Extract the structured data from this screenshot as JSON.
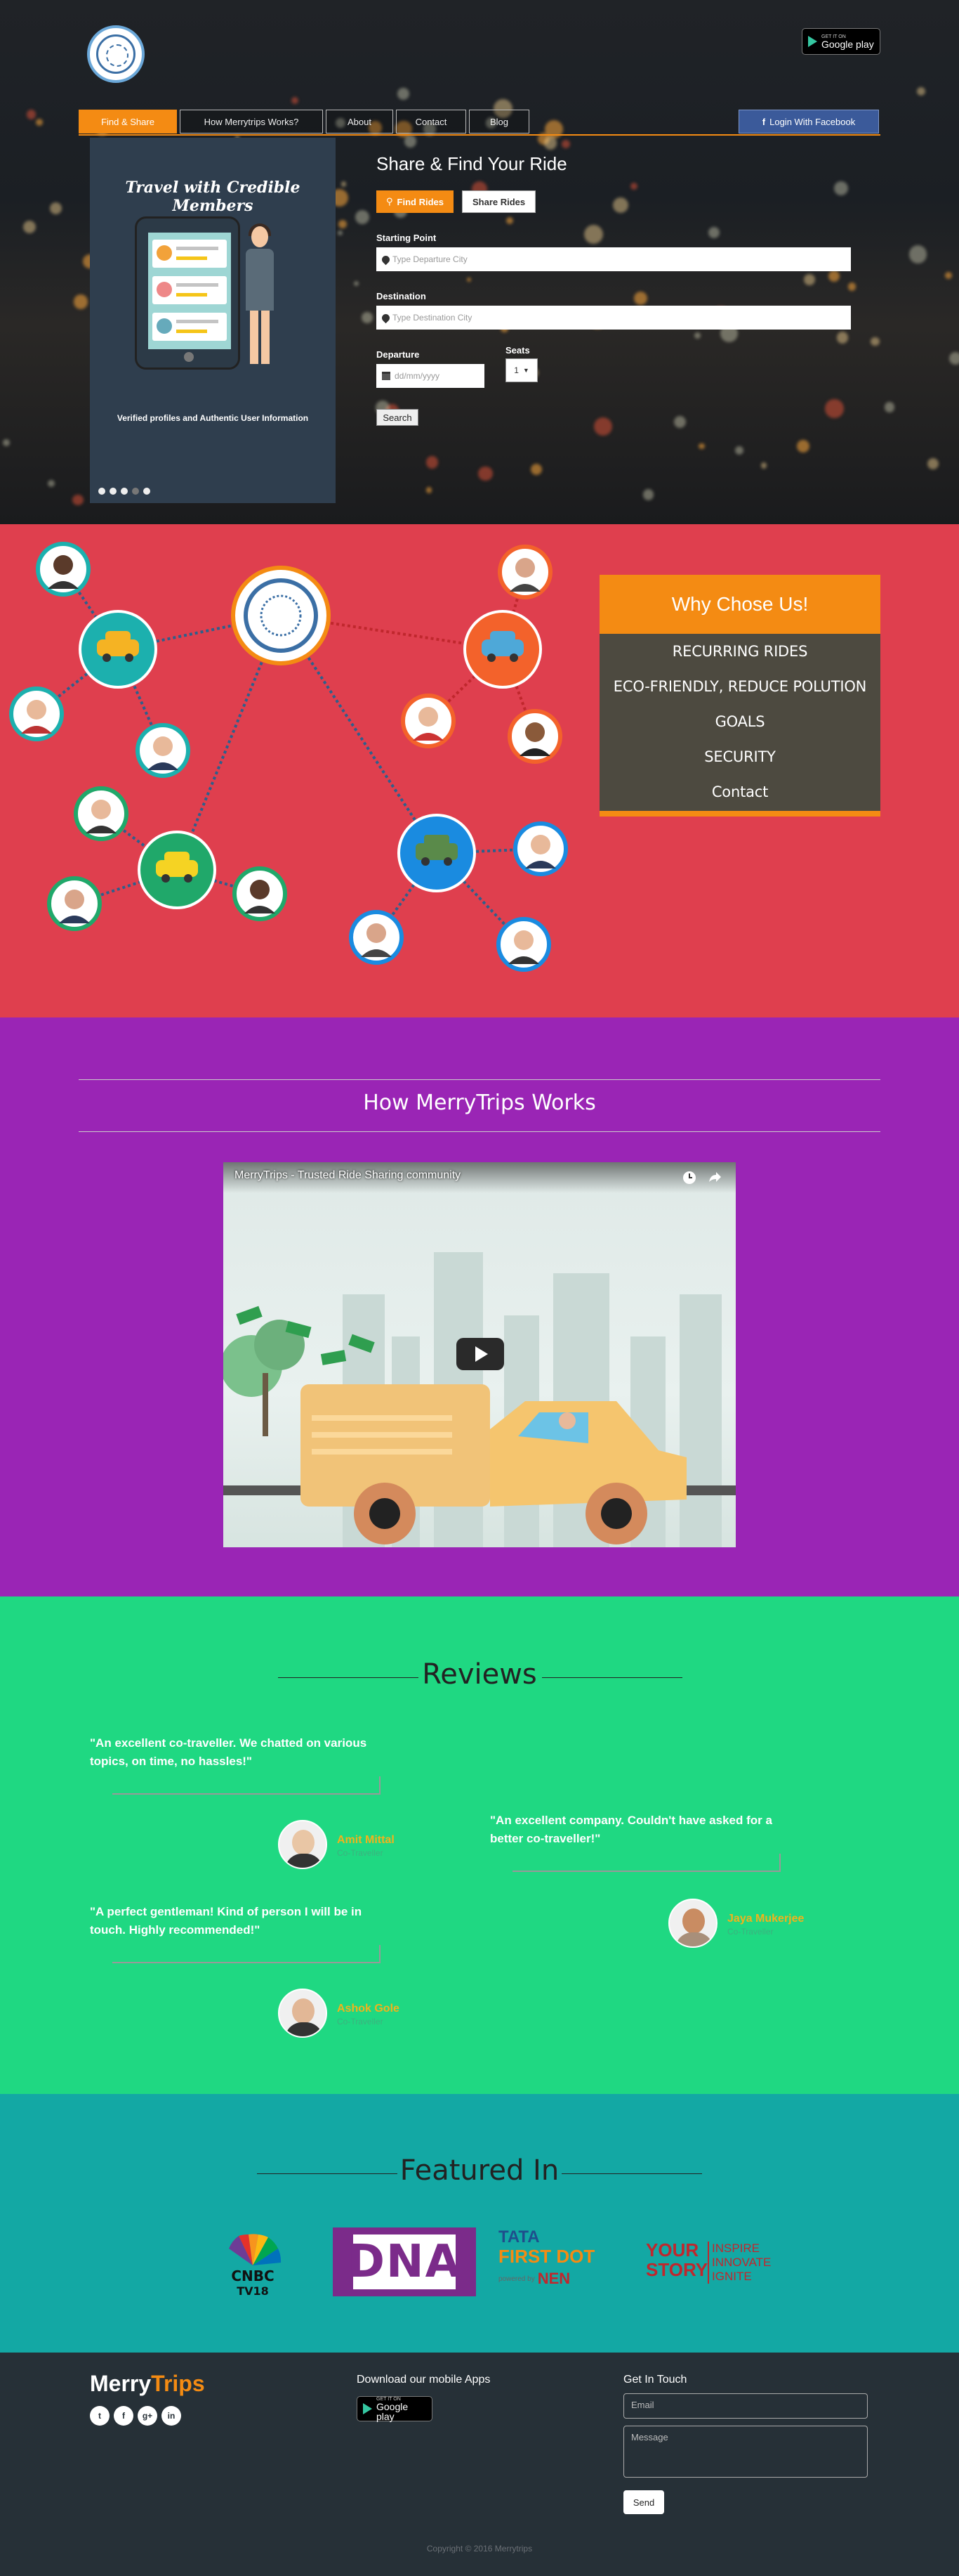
{
  "hero": {
    "nav": [
      {
        "label": "Find & Share",
        "active": true
      },
      {
        "label": "How Merrytrips Works?"
      },
      {
        "label": "About"
      },
      {
        "label": "Contact"
      },
      {
        "label": "Blog"
      }
    ],
    "fb_button": "Login With Facebook",
    "google_play": {
      "small": "GET IT ON",
      "large": "Google play"
    },
    "carousel": {
      "title": "Travel with Credible Members",
      "subtitle": "Verified profiles and Authentic User Information"
    },
    "form": {
      "title": "Share & Find Your Ride",
      "find_label": "Find Rides",
      "share_label": "Share Rides",
      "start_label": "Starting Point",
      "start_placeholder": "Type Departure City",
      "dest_label": "Destination",
      "dest_placeholder": "Type Destination City",
      "departure_label": "Departure",
      "date_placeholder": "dd/mm/yyyy",
      "seats_label": "Seats",
      "seats_value": "1",
      "search_label": "Search"
    }
  },
  "why": {
    "title": "Why Chose Us!",
    "items": [
      "RECURRING RIDES",
      "ECO-FRIENDLY, REDUCE POLUTION",
      "GOALS",
      "SECURITY",
      "Contact"
    ]
  },
  "how": {
    "title": "How MerryTrips Works",
    "video_title": "MerryTrips - Trusted Ride Sharing community"
  },
  "reviews": {
    "title": "Reviews",
    "items": [
      {
        "quote": "\"An excellent co-traveller. We chatted on various topics, on time, no hassles!\"",
        "name": "Amit Mittal",
        "sub": "Co-Traveller"
      },
      {
        "quote": "\"An excellent company. Couldn't have asked for a better co-traveller!\"",
        "name": "Jaya Mukerjee",
        "sub": "Co-Traveller"
      },
      {
        "quote": "\"A perfect gentleman! Kind of person I will be in touch. Highly recommended!\"",
        "name": "Ashok Gole",
        "sub": "Co-Traveller"
      }
    ]
  },
  "featured": {
    "title": "Featured In",
    "logos": {
      "cnbc": "CNBC TV18",
      "dna": "DNA",
      "tata_top": "TATA",
      "tata_mid": "FIRST DOT",
      "tata_bottom": "powered by",
      "nen": "NEN",
      "ys_left": [
        "YOUR",
        "STORY"
      ],
      "ys_right": [
        "INSPIRE",
        "INNOVATE",
        "IGNITE"
      ]
    }
  },
  "footer": {
    "brand_a": "Merry",
    "brand_b": "Trips",
    "apps_title": "Download our mobile Apps",
    "contact_title": "Get In Touch",
    "email_placeholder": "Email",
    "message_placeholder": "Message",
    "send_label": "Send",
    "copyright": "Copyright © 2016 Merrytrips",
    "social": [
      "t",
      "f",
      "g+",
      "in"
    ]
  },
  "colors": {
    "accent": "#f48b13",
    "why_bg": "#df3f4e",
    "how_bg": "#9a25b5",
    "reviews_bg": "#1fd882",
    "featured_bg": "#13a8a4",
    "footer_bg": "#263037"
  }
}
